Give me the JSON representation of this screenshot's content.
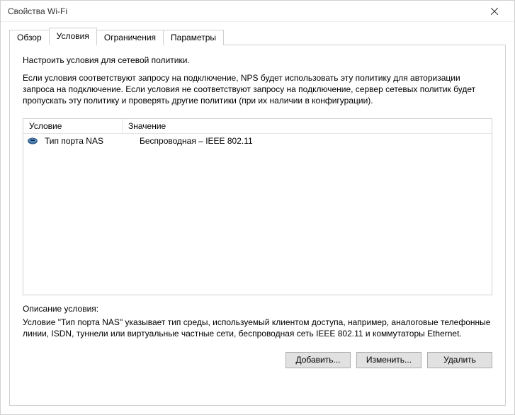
{
  "window": {
    "title": "Свойства Wi-Fi"
  },
  "tabs": [
    {
      "label": "Обзор",
      "active": false
    },
    {
      "label": "Условия",
      "active": true
    },
    {
      "label": "Ограничения",
      "active": false
    },
    {
      "label": "Параметры",
      "active": false
    }
  ],
  "intro": "Настроить условия для сетевой политики.",
  "description": "Если условия соответствуют запросу на подключение, NPS будет использовать эту политику для авторизации запроса на подключение. Если условия не соответствуют запросу на подключение, сервер сетевых политик будет пропускать эту политику и проверять другие политики (при их наличии в конфигурации).",
  "list": {
    "headers": {
      "condition": "Условие",
      "value": "Значение"
    },
    "rows": [
      {
        "icon": "nas-port-icon",
        "condition": "Тип порта NAS",
        "value": "Беспроводная – IEEE 802.11"
      }
    ]
  },
  "condition_desc": {
    "heading": "Описание условия:",
    "text": "Условие \"Тип порта NAS\" указывает тип среды, используемый клиентом доступа, например, аналоговые телефонные линии, ISDN, туннели или виртуальные частные сети, беспроводная сеть IEEE 802.11 и коммутаторы Ethernet."
  },
  "buttons": {
    "add": "Добавить...",
    "edit": "Изменить...",
    "remove": "Удалить"
  }
}
